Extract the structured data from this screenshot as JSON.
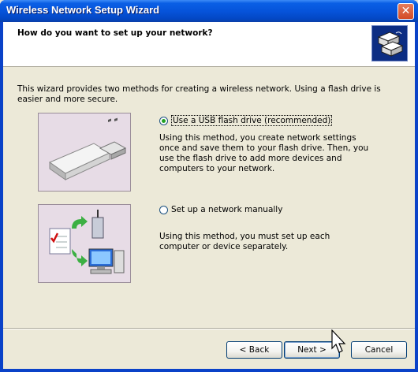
{
  "window": {
    "title": "Wireless Network Setup Wizard",
    "close_glyph": "✕"
  },
  "header": {
    "heading": "How do you want to set up your network?",
    "icon": "network-wizard-icon"
  },
  "intro": "This wizard provides two methods for creating a wireless network. Using a flash drive is easier and more secure.",
  "options": [
    {
      "label": "Use a USB flash drive (recommended)",
      "selected": true,
      "description": "Using this method, you create network settings once and save them to your flash drive. Then, you use the flash drive to add more devices and computers to your network.",
      "image": "usb-flash-drive-icon"
    },
    {
      "label": "Set up a network manually",
      "selected": false,
      "description": "Using this method, you must set up each computer or device separately.",
      "image": "manual-network-setup-icon"
    }
  ],
  "buttons": {
    "back": "< Back",
    "next": "Next >",
    "cancel": "Cancel"
  },
  "colors": {
    "titlebar": "#0654db",
    "face": "#ece9d8",
    "radio_dot": "#21a121",
    "picture_bg": "#e7dce6"
  }
}
